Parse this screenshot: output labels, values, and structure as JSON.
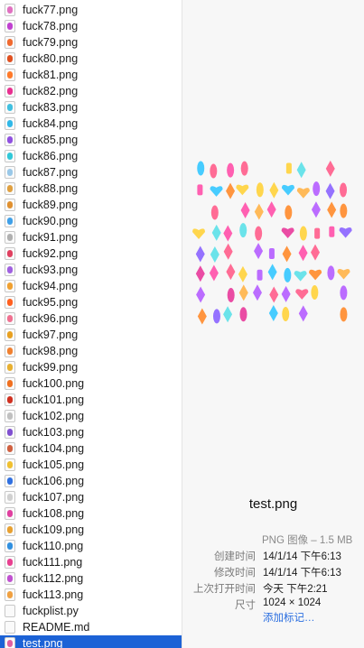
{
  "files": [
    {
      "name": "fuck77.png",
      "icon": "#e070c0"
    },
    {
      "name": "fuck78.png",
      "icon": "#c040d0"
    },
    {
      "name": "fuck79.png",
      "icon": "#f06a30"
    },
    {
      "name": "fuck80.png",
      "icon": "#e05020"
    },
    {
      "name": "fuck81.png",
      "icon": "#ff7a2a"
    },
    {
      "name": "fuck82.png",
      "icon": "#e83090"
    },
    {
      "name": "fuck83.png",
      "icon": "#40c0e0"
    },
    {
      "name": "fuck84.png",
      "icon": "#30b8e8"
    },
    {
      "name": "fuck85.png",
      "icon": "#9050e0"
    },
    {
      "name": "fuck86.png",
      "icon": "#30c8d8"
    },
    {
      "name": "fuck87.png",
      "icon": "#9ac8e8"
    },
    {
      "name": "fuck88.png",
      "icon": "#e0a040"
    },
    {
      "name": "fuck89.png",
      "icon": "#e09030"
    },
    {
      "name": "fuck90.png",
      "icon": "#40a0e8"
    },
    {
      "name": "fuck91.png",
      "icon": "#b0b0b0"
    },
    {
      "name": "fuck92.png",
      "icon": "#e04060"
    },
    {
      "name": "fuck93.png",
      "icon": "#a060e0"
    },
    {
      "name": "fuck94.png",
      "icon": "#f0a030"
    },
    {
      "name": "fuck95.png",
      "icon": "#ff6020"
    },
    {
      "name": "fuck96.png",
      "icon": "#f07090"
    },
    {
      "name": "fuck97.png",
      "icon": "#e8a020"
    },
    {
      "name": "fuck98.png",
      "icon": "#f08030"
    },
    {
      "name": "fuck99.png",
      "icon": "#e8b030"
    },
    {
      "name": "fuck100.png",
      "icon": "#f07020"
    },
    {
      "name": "fuck101.png",
      "icon": "#d03020"
    },
    {
      "name": "fuck102.png",
      "icon": "#c0c0c0"
    },
    {
      "name": "fuck103.png",
      "icon": "#8050d0"
    },
    {
      "name": "fuck104.png",
      "icon": "#d06040"
    },
    {
      "name": "fuck105.png",
      "icon": "#f0c030"
    },
    {
      "name": "fuck106.png",
      "icon": "#3070e0"
    },
    {
      "name": "fuck107.png",
      "icon": "#d0d0d0"
    },
    {
      "name": "fuck108.png",
      "icon": "#e040a0"
    },
    {
      "name": "fuck109.png",
      "icon": "#e8a030"
    },
    {
      "name": "fuck110.png",
      "icon": "#3090e0"
    },
    {
      "name": "fuck111.png",
      "icon": "#e84090"
    },
    {
      "name": "fuck112.png",
      "icon": "#c050d0"
    },
    {
      "name": "fuck113.png",
      "icon": "#f0a040"
    },
    {
      "name": "fuckplist.py",
      "icon": "#ffffff"
    },
    {
      "name": "README.md",
      "icon": "#ffffff"
    },
    {
      "name": "test.png",
      "icon": "#e060a0",
      "selected": true
    }
  ],
  "preview": {
    "title": "test.png",
    "kind": "PNG 图像 – 1.5 MB",
    "meta": [
      {
        "key": "创建时间",
        "value": "14/1/14 下午6:13"
      },
      {
        "key": "修改时间",
        "value": "14/1/14 下午6:13"
      },
      {
        "key": "上次打开时间",
        "value": "今天 下午2:21"
      },
      {
        "key": "尺寸",
        "value": "1024 × 1024"
      }
    ],
    "add_tags": "添加标记…"
  },
  "colors": {
    "selection": "#1c62d6",
    "link": "#2a6ee0",
    "sprite_palette": [
      "#ff4fa8",
      "#ff8a2a",
      "#33c6ff",
      "#b45cff",
      "#ffd23a",
      "#ff5c8a",
      "#5be0e8",
      "#8a63ff",
      "#ffb347",
      "#e8399a"
    ]
  }
}
